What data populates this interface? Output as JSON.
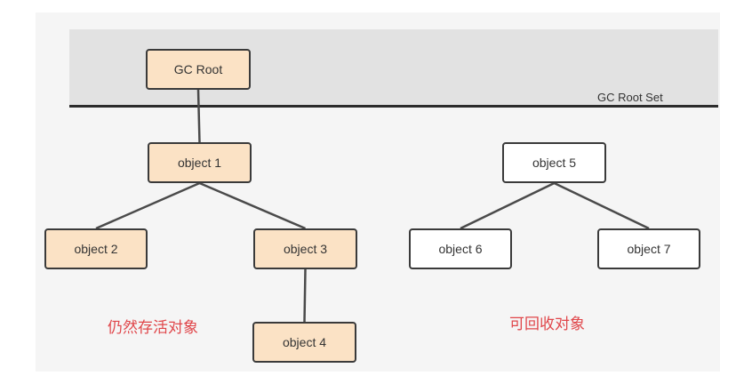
{
  "band_label": "GC Root Set",
  "colors": {
    "live_fill": "#fbe2c5",
    "dead_fill": "#ffffff",
    "border": "#3a3a3a",
    "caption": "#e0464a",
    "band": "#e2e2e2"
  },
  "nodes": {
    "gc_root": "GC Root",
    "object1": "object 1",
    "object2": "object 2",
    "object3": "object 3",
    "object4": "object 4",
    "object5": "object 5",
    "object6": "object 6",
    "object7": "object 7"
  },
  "edges": [
    [
      "gc_root",
      "object1"
    ],
    [
      "object1",
      "object2"
    ],
    [
      "object1",
      "object3"
    ],
    [
      "object3",
      "object4"
    ],
    [
      "object5",
      "object6"
    ],
    [
      "object5",
      "object7"
    ]
  ],
  "captions": {
    "live": "仍然存活对象",
    "collectable": "可回收对象"
  }
}
